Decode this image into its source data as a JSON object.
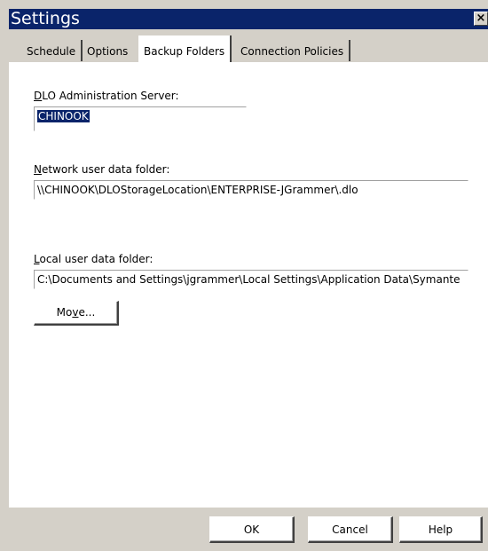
{
  "window": {
    "title": "Settings",
    "close_glyph": "×"
  },
  "tabs": [
    {
      "label": "Schedule",
      "active": false
    },
    {
      "label": "Options",
      "active": false
    },
    {
      "label": "Backup Folders",
      "active": true
    },
    {
      "label": "Connection Policies",
      "active": false
    }
  ],
  "backup_folders": {
    "dlo_server_label_mnemonic": "D",
    "dlo_server_label_rest": "LO Administration Server:",
    "dlo_server_value": "CHINOOK",
    "network_folder_label_mnemonic": "N",
    "network_folder_label_rest": "etwork user data folder:",
    "network_folder_value": "\\\\CHINOOK\\DLOStorageLocation\\ENTERPRISE-JGrammer\\.dlo",
    "local_folder_label_mnemonic": "L",
    "local_folder_label_rest": "ocal user data folder:",
    "local_folder_value": "C:\\Documents and Settings\\jgrammer\\Local Settings\\Application Data\\Symante",
    "move_button_pre": "Mo",
    "move_button_mnemonic": "v",
    "move_button_post": "e..."
  },
  "buttons": {
    "ok": "OK",
    "cancel": "Cancel",
    "help": "Help"
  },
  "colors": {
    "titlebar": "#0a246a",
    "dialog_face": "#d4d0c8",
    "selection": "#0a246a"
  }
}
